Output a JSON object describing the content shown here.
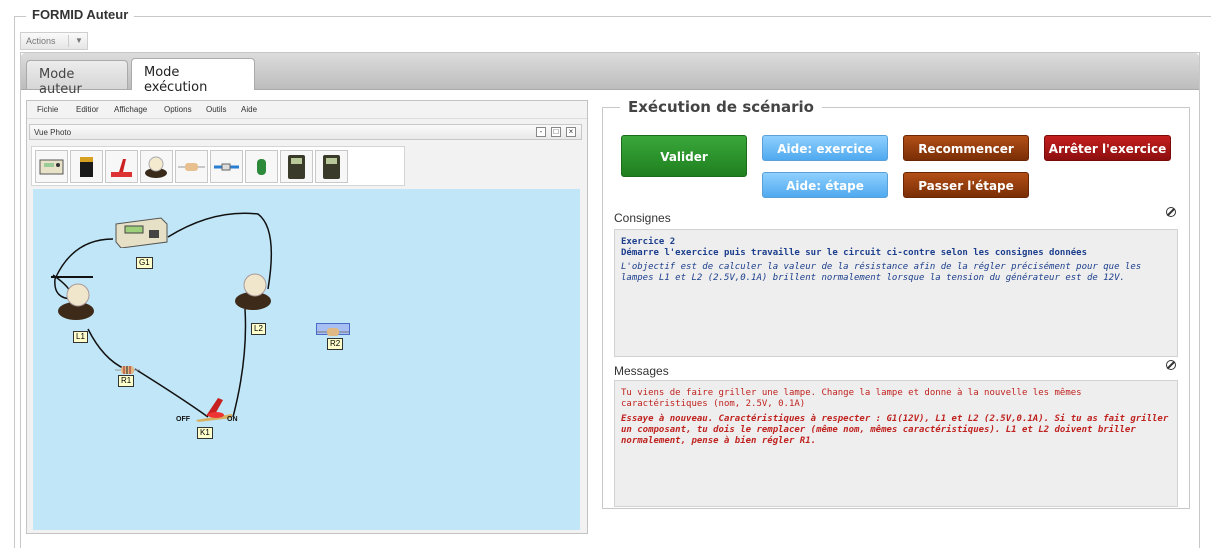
{
  "app": {
    "title": "FORMID Auteur",
    "actions_label": "Actions"
  },
  "tabs": [
    {
      "label": "Mode auteur",
      "active": false
    },
    {
      "label": "Mode exécution",
      "active": true
    }
  ],
  "editor": {
    "menu": [
      "Fichie",
      "Editior",
      "Affichage",
      "Options",
      "Outils",
      "Aide"
    ],
    "view_title": "Vue Photo",
    "palette": [
      "generator",
      "battery",
      "switch",
      "lamp",
      "resistor",
      "wire-connector",
      "diode",
      "multimeter",
      "ammeter"
    ],
    "components": {
      "g1": "G1",
      "l1": "L1",
      "l2": "L2",
      "r1": "R1",
      "r2": "R2",
      "k1": "K1",
      "off": "OFF",
      "on": "ON"
    }
  },
  "execution": {
    "title": "Exécution de scénario",
    "buttons": {
      "valider": "Valider",
      "aide_exercice": "Aide: exercice",
      "aide_etape": "Aide: étape",
      "recommencer": "Recommencer",
      "passer": "Passer l'étape",
      "arreter": "Arrêter l'exercice"
    },
    "colors": {
      "green": "#2e8b2e",
      "blue": "#5ab0f0",
      "brown": "#8b3a0c",
      "red": "#a51515"
    },
    "consignes": {
      "label": "Consignes",
      "title": "Exercice 2",
      "subtitle": "Démarre l'exercice puis travaille sur le circuit ci-contre selon les consignes données",
      "body": "L'objectif est de calculer la valeur de la résistance afin de la régler précisément pour que les lampes L1 et L2 (2.5V,0.1A) brillent normalement lorsque la tension du générateur est de 12V."
    },
    "messages": {
      "label": "Messages",
      "line1": "Tu viens de faire griller une lampe. Change la lampe et donne à la nouvelle les mêmes caractéristiques (nom, 2.5V, 0.1A)",
      "line2": "Essaye à nouveau. Caractéristiques à respecter : G1(12V), L1 et L2 (2.5V,0.1A). Si tu as fait griller un composant, tu dois le remplacer (même nom, mêmes caractéristiques). L1 et L2 doivent briller normalement, pense à bien régler R1."
    }
  }
}
